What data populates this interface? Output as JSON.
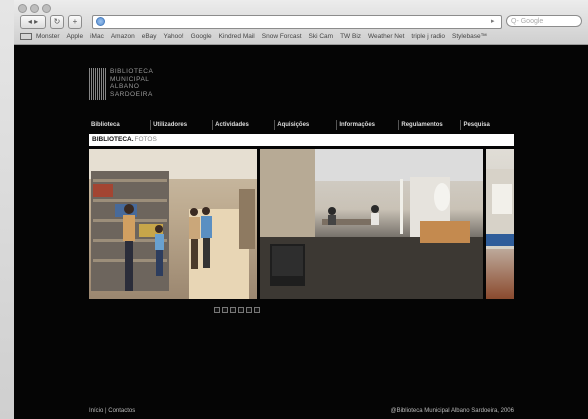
{
  "browser": {
    "address_url": "",
    "search_placeholder": "Google",
    "bookmarks": [
      "Monster",
      "Apple",
      "iMac",
      "Amazon",
      "eBay",
      "Yahoo!",
      "Google",
      "Kindred Mail",
      "Snow Forcast",
      "Ski Cam",
      "TW Biz",
      "Weather Net",
      "triple j radio",
      "Stylebase™"
    ]
  },
  "site": {
    "logo_text": "BIBLIOTECA\nMUNICIPAL\nALBANO\nSARDOEIRA",
    "menu": [
      "Biblioteca",
      "Utilizadores",
      "Actividades",
      "Aquisições",
      "Informações",
      "Regulamentos",
      "Pesquisa"
    ],
    "tab_title": "BIBLIOTECA.",
    "tab_sub": "FOTOS",
    "pager_count": 6,
    "footer_left": "Início | Contactos",
    "footer_right": "@Biblioteca Municipal Albano Sardoeira, 2006"
  }
}
